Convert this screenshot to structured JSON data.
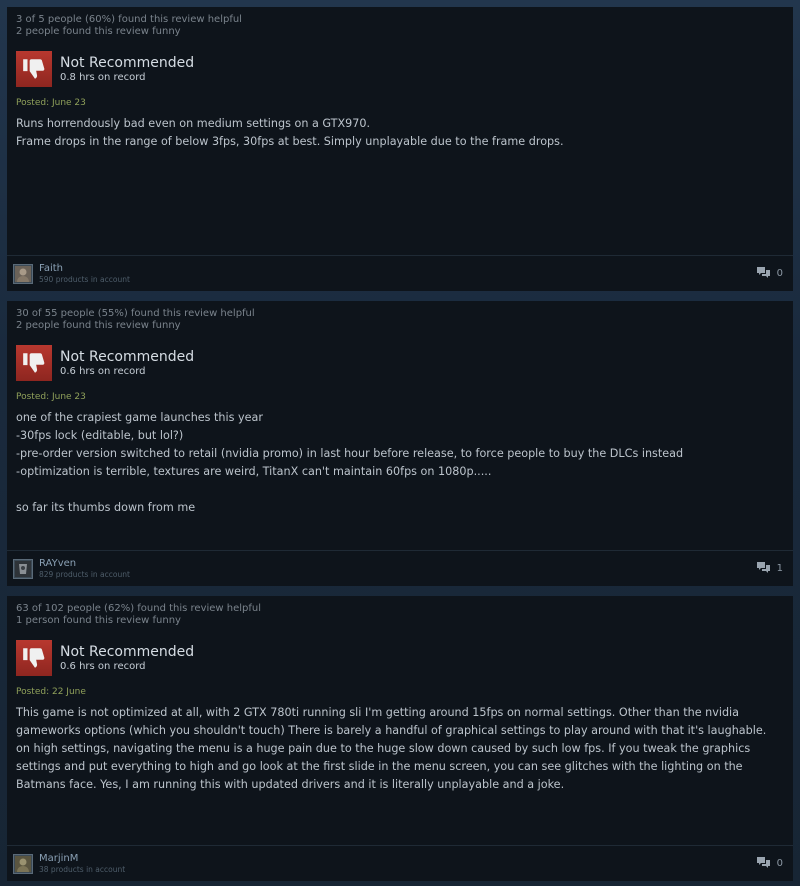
{
  "reviews": [
    {
      "helpful": "3 of 5 people (60%) found this review helpful",
      "funny": "2 people found this review funny",
      "verdict": "Not Recommended",
      "hours": "0.8 hrs on record",
      "posted": "Posted: June 23",
      "body": [
        "Runs horrendously bad even on medium settings on a GTX970.",
        "Frame drops in the range of below 3fps, 30fps at best. Simply unplayable due to the frame drops."
      ],
      "user": "Faith",
      "products": "590 products in account",
      "comments": "0"
    },
    {
      "helpful": "30 of 55 people (55%) found this review helpful",
      "funny": "2 people found this review funny",
      "verdict": "Not Recommended",
      "hours": "0.6 hrs on record",
      "posted": "Posted: June 23",
      "body": [
        "one of the crapiest game launches this year",
        "-30fps lock (editable, but lol?)",
        "-pre-order version switched to retail (nvidia promo) in last hour before release, to force people to buy the DLCs instead",
        "-optimization is terrible, textures are weird, TitanX can't maintain 60fps on 1080p.....",
        "",
        "so far its thumbs down from me"
      ],
      "user": "RAYven",
      "products": "829 products in account",
      "comments": "1"
    },
    {
      "helpful": "63 of 102 people (62%) found this review helpful",
      "funny": "1 person found this review funny",
      "verdict": "Not Recommended",
      "hours": "0.6 hrs on record",
      "posted": "Posted: 22 June",
      "body": [
        "This game is not optimized at all, with 2 GTX 780ti running sli I'm getting around 15fps on normal settings. Other than the nvidia gameworks options (which you shouldn't touch) There is barely a handful of graphical settings to play around with that it's laughable. on high settings, navigating the menu is a huge pain due to the huge slow down caused by such low fps. If you tweak the graphics settings and put everything to high and go look at the first slide in the menu screen, you can see glitches with the lighting on the Batmans face. Yes, I am running this with updated drivers and it is literally unplayable and a joke."
      ],
      "user": "MarjinM",
      "products": "38 products in account",
      "comments": "0"
    }
  ],
  "icons": {
    "verdict": "thumbs-down-icon",
    "comments": "comment-bubbles-icon",
    "avatar": "user-avatar"
  },
  "colors": {
    "background": "#1b2838",
    "card": "#0e141b",
    "thumb_box": "#a3302a",
    "posted": "#8fa05a",
    "helpful_text": "#7a838c"
  }
}
